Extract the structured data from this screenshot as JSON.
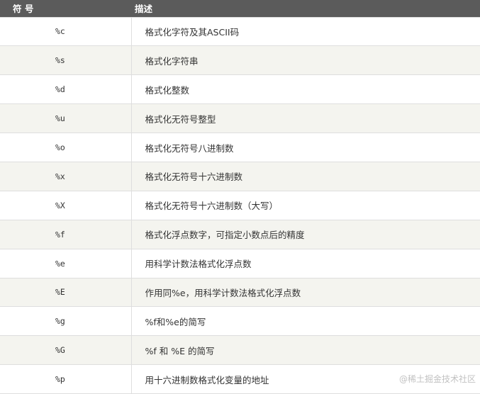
{
  "table": {
    "headers": [
      "符 号",
      "描述"
    ],
    "rows": [
      {
        "symbol": "%c",
        "desc": "格式化字符及其ASCII码"
      },
      {
        "symbol": "%s",
        "desc": "格式化字符串"
      },
      {
        "symbol": "%d",
        "desc": "格式化整数"
      },
      {
        "symbol": "%u",
        "desc": "格式化无符号整型"
      },
      {
        "symbol": "%o",
        "desc": "格式化无符号八进制数"
      },
      {
        "symbol": "%x",
        "desc": "格式化无符号十六进制数"
      },
      {
        "symbol": "%X",
        "desc": "格式化无符号十六进制数（大写）"
      },
      {
        "symbol": "%f",
        "desc": "格式化浮点数字，可指定小数点后的精度"
      },
      {
        "symbol": "%e",
        "desc": "用科学计数法格式化浮点数"
      },
      {
        "symbol": "%E",
        "desc": "作用同%e，用科学计数法格式化浮点数"
      },
      {
        "symbol": "%g",
        "desc": "%f和%e的简写"
      },
      {
        "symbol": "%G",
        "desc": "%f 和 %E 的简写"
      },
      {
        "symbol": "%p",
        "desc": "用十六进制数格式化变量的地址"
      }
    ]
  },
  "watermark": "@稀土掘金技术社区"
}
